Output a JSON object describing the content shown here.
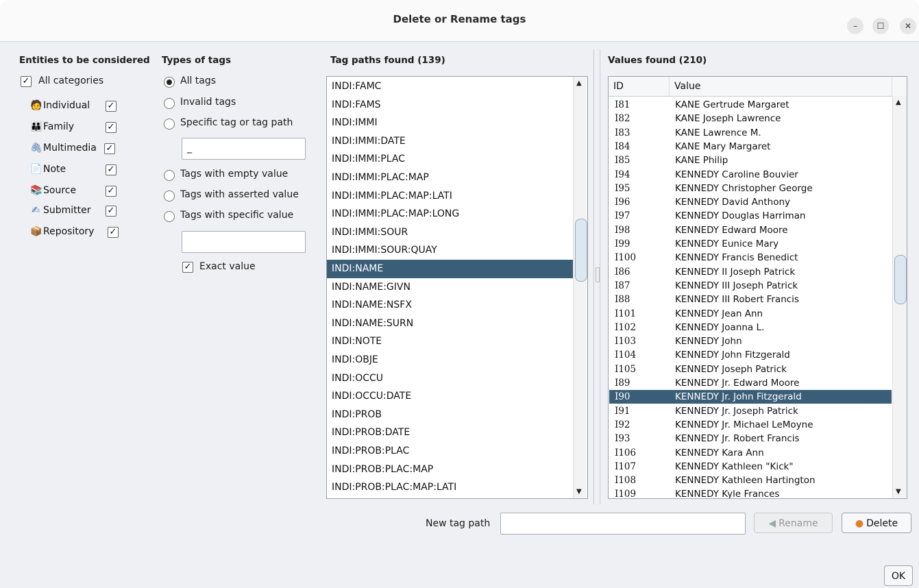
{
  "window": {
    "title": "Delete or Rename tags",
    "controls": [
      "–",
      "☐",
      "✕"
    ]
  },
  "entities": {
    "heading": "Entities to be considered",
    "all_label": "All categories",
    "items": [
      {
        "label": "Individual",
        "icon": "🧑"
      },
      {
        "label": "Family",
        "icon": "👪"
      },
      {
        "label": "Multimedia",
        "icon": "🖇"
      },
      {
        "label": "Note",
        "icon": "📄"
      },
      {
        "label": "Source",
        "icon": "📚"
      },
      {
        "label": "Submitter",
        "icon": "✍"
      },
      {
        "label": "Repository",
        "icon": "📦"
      }
    ]
  },
  "types": {
    "heading": "Types of tags",
    "options": [
      "All tags",
      "Invalid tags",
      "Specific tag or tag path",
      "Tags with empty value",
      "Tags with asserted value",
      "Tags with specific value"
    ],
    "selected": "All tags",
    "specific_tag_value": "_",
    "specific_value": "",
    "exact_label": "Exact value"
  },
  "paths": {
    "heading": "Tag paths found (139)",
    "items": [
      "INDI:FAMC",
      "INDI:FAMS",
      "INDI:IMMI",
      "INDI:IMMI:DATE",
      "INDI:IMMI:PLAC",
      "INDI:IMMI:PLAC:MAP",
      "INDI:IMMI:PLAC:MAP:LATI",
      "INDI:IMMI:PLAC:MAP:LONG",
      "INDI:IMMI:SOUR",
      "INDI:IMMI:SOUR:QUAY",
      "INDI:NAME",
      "INDI:NAME:GIVN",
      "INDI:NAME:NSFX",
      "INDI:NAME:SURN",
      "INDI:NOTE",
      "INDI:OBJE",
      "INDI:OCCU",
      "INDI:OCCU:DATE",
      "INDI:PROB",
      "INDI:PROB:DATE",
      "INDI:PROB:PLAC",
      "INDI:PROB:PLAC:MAP",
      "INDI:PROB:PLAC:MAP:LATI"
    ],
    "selected": "INDI:NAME"
  },
  "values": {
    "heading": "Values found (210)",
    "columns": [
      "ID",
      "Value"
    ],
    "rows": [
      [
        "I81",
        "KANE Gertrude Margaret"
      ],
      [
        "I82",
        "KANE Joseph Lawrence"
      ],
      [
        "I83",
        "KANE Lawrence M."
      ],
      [
        "I84",
        "KANE Mary Margaret"
      ],
      [
        "I85",
        "KANE Philip"
      ],
      [
        "I94",
        "KENNEDY Caroline Bouvier"
      ],
      [
        "I95",
        "KENNEDY Christopher George"
      ],
      [
        "I96",
        "KENNEDY David Anthony"
      ],
      [
        "I97",
        "KENNEDY Douglas Harriman"
      ],
      [
        "I98",
        "KENNEDY Edward Moore"
      ],
      [
        "I99",
        "KENNEDY Eunice Mary"
      ],
      [
        "I100",
        "KENNEDY Francis Benedict"
      ],
      [
        "I86",
        "KENNEDY II Joseph Patrick"
      ],
      [
        "I87",
        "KENNEDY III Joseph Patrick"
      ],
      [
        "I88",
        "KENNEDY III Robert Francis"
      ],
      [
        "I101",
        "KENNEDY Jean Ann"
      ],
      [
        "I102",
        "KENNEDY Joanna L."
      ],
      [
        "I103",
        "KENNEDY John"
      ],
      [
        "I104",
        "KENNEDY John Fitzgerald"
      ],
      [
        "I105",
        "KENNEDY Joseph Patrick"
      ],
      [
        "I89",
        "KENNEDY Jr. Edward Moore"
      ],
      [
        "I90",
        "KENNEDY Jr. John Fitzgerald"
      ],
      [
        "I91",
        "KENNEDY Jr. Joseph Patrick"
      ],
      [
        "I92",
        "KENNEDY Jr. Michael LeMoyne"
      ],
      [
        "I93",
        "KENNEDY Jr. Robert Francis"
      ],
      [
        "I106",
        "KENNEDY Kara Ann"
      ],
      [
        "I107",
        "KENNEDY Kathleen \"Kick\""
      ],
      [
        "I108",
        "KENNEDY Kathleen Hartington"
      ],
      [
        "I109",
        "KENNEDY Kyle Frances"
      ]
    ],
    "selected": "I90"
  },
  "bottom": {
    "new_tag_label": "New tag path",
    "new_tag_value": "",
    "rename_label": "Rename",
    "delete_label": "Delete",
    "ok_label": "OK"
  }
}
